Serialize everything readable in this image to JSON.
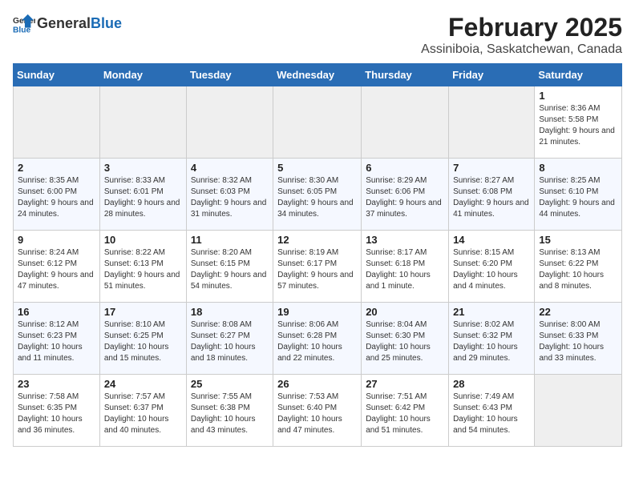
{
  "header": {
    "logo_general": "General",
    "logo_blue": "Blue",
    "month": "February 2025",
    "location": "Assiniboia, Saskatchewan, Canada"
  },
  "days_of_week": [
    "Sunday",
    "Monday",
    "Tuesday",
    "Wednesday",
    "Thursday",
    "Friday",
    "Saturday"
  ],
  "weeks": [
    [
      {
        "day": "",
        "detail": ""
      },
      {
        "day": "",
        "detail": ""
      },
      {
        "day": "",
        "detail": ""
      },
      {
        "day": "",
        "detail": ""
      },
      {
        "day": "",
        "detail": ""
      },
      {
        "day": "",
        "detail": ""
      },
      {
        "day": "1",
        "detail": "Sunrise: 8:36 AM\nSunset: 5:58 PM\nDaylight: 9 hours and 21 minutes."
      }
    ],
    [
      {
        "day": "2",
        "detail": "Sunrise: 8:35 AM\nSunset: 6:00 PM\nDaylight: 9 hours and 24 minutes."
      },
      {
        "day": "3",
        "detail": "Sunrise: 8:33 AM\nSunset: 6:01 PM\nDaylight: 9 hours and 28 minutes."
      },
      {
        "day": "4",
        "detail": "Sunrise: 8:32 AM\nSunset: 6:03 PM\nDaylight: 9 hours and 31 minutes."
      },
      {
        "day": "5",
        "detail": "Sunrise: 8:30 AM\nSunset: 6:05 PM\nDaylight: 9 hours and 34 minutes."
      },
      {
        "day": "6",
        "detail": "Sunrise: 8:29 AM\nSunset: 6:06 PM\nDaylight: 9 hours and 37 minutes."
      },
      {
        "day": "7",
        "detail": "Sunrise: 8:27 AM\nSunset: 6:08 PM\nDaylight: 9 hours and 41 minutes."
      },
      {
        "day": "8",
        "detail": "Sunrise: 8:25 AM\nSunset: 6:10 PM\nDaylight: 9 hours and 44 minutes."
      }
    ],
    [
      {
        "day": "9",
        "detail": "Sunrise: 8:24 AM\nSunset: 6:12 PM\nDaylight: 9 hours and 47 minutes."
      },
      {
        "day": "10",
        "detail": "Sunrise: 8:22 AM\nSunset: 6:13 PM\nDaylight: 9 hours and 51 minutes."
      },
      {
        "day": "11",
        "detail": "Sunrise: 8:20 AM\nSunset: 6:15 PM\nDaylight: 9 hours and 54 minutes."
      },
      {
        "day": "12",
        "detail": "Sunrise: 8:19 AM\nSunset: 6:17 PM\nDaylight: 9 hours and 57 minutes."
      },
      {
        "day": "13",
        "detail": "Sunrise: 8:17 AM\nSunset: 6:18 PM\nDaylight: 10 hours and 1 minute."
      },
      {
        "day": "14",
        "detail": "Sunrise: 8:15 AM\nSunset: 6:20 PM\nDaylight: 10 hours and 4 minutes."
      },
      {
        "day": "15",
        "detail": "Sunrise: 8:13 AM\nSunset: 6:22 PM\nDaylight: 10 hours and 8 minutes."
      }
    ],
    [
      {
        "day": "16",
        "detail": "Sunrise: 8:12 AM\nSunset: 6:23 PM\nDaylight: 10 hours and 11 minutes."
      },
      {
        "day": "17",
        "detail": "Sunrise: 8:10 AM\nSunset: 6:25 PM\nDaylight: 10 hours and 15 minutes."
      },
      {
        "day": "18",
        "detail": "Sunrise: 8:08 AM\nSunset: 6:27 PM\nDaylight: 10 hours and 18 minutes."
      },
      {
        "day": "19",
        "detail": "Sunrise: 8:06 AM\nSunset: 6:28 PM\nDaylight: 10 hours and 22 minutes."
      },
      {
        "day": "20",
        "detail": "Sunrise: 8:04 AM\nSunset: 6:30 PM\nDaylight: 10 hours and 25 minutes."
      },
      {
        "day": "21",
        "detail": "Sunrise: 8:02 AM\nSunset: 6:32 PM\nDaylight: 10 hours and 29 minutes."
      },
      {
        "day": "22",
        "detail": "Sunrise: 8:00 AM\nSunset: 6:33 PM\nDaylight: 10 hours and 33 minutes."
      }
    ],
    [
      {
        "day": "23",
        "detail": "Sunrise: 7:58 AM\nSunset: 6:35 PM\nDaylight: 10 hours and 36 minutes."
      },
      {
        "day": "24",
        "detail": "Sunrise: 7:57 AM\nSunset: 6:37 PM\nDaylight: 10 hours and 40 minutes."
      },
      {
        "day": "25",
        "detail": "Sunrise: 7:55 AM\nSunset: 6:38 PM\nDaylight: 10 hours and 43 minutes."
      },
      {
        "day": "26",
        "detail": "Sunrise: 7:53 AM\nSunset: 6:40 PM\nDaylight: 10 hours and 47 minutes."
      },
      {
        "day": "27",
        "detail": "Sunrise: 7:51 AM\nSunset: 6:42 PM\nDaylight: 10 hours and 51 minutes."
      },
      {
        "day": "28",
        "detail": "Sunrise: 7:49 AM\nSunset: 6:43 PM\nDaylight: 10 hours and 54 minutes."
      },
      {
        "day": "",
        "detail": ""
      }
    ]
  ]
}
